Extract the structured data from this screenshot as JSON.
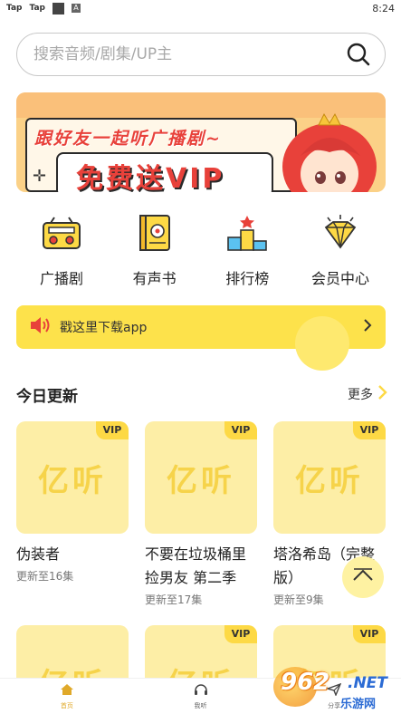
{
  "status_bar": {
    "left_items": [
      "Tap",
      "Tap"
    ],
    "a_badge": "A",
    "time": "8:24"
  },
  "search": {
    "placeholder": "搜索音频/剧集/UP主"
  },
  "banner": {
    "title": "跟好友一起听广播剧~",
    "main": "免费送VIP"
  },
  "categories": [
    {
      "label": "广播剧",
      "icon": "radio-icon"
    },
    {
      "label": "有声书",
      "icon": "audiobook-icon"
    },
    {
      "label": "排行榜",
      "icon": "podium-icon"
    },
    {
      "label": "会员中心",
      "icon": "diamond-icon"
    }
  ],
  "download": {
    "label": "戳这里下载app"
  },
  "section": {
    "title": "今日更新",
    "more": "更多"
  },
  "cards": [
    {
      "title": "伪装者",
      "sub": "更新至16集",
      "badge": "VIP",
      "cover_text": "亿听"
    },
    {
      "title": "不要在垃圾桶里捡男友 第二季",
      "sub": "更新至17集",
      "badge": "VIP",
      "cover_text": "亿听"
    },
    {
      "title": "塔洛希岛（完整版）",
      "sub": "更新至9集",
      "badge": "VIP",
      "cover_text": "亿听"
    },
    {
      "title": "",
      "sub": "",
      "badge": "",
      "cover_text": "亿听"
    },
    {
      "title": "",
      "sub": "",
      "badge": "VIP",
      "cover_text": "亿听"
    },
    {
      "title": "",
      "sub": "",
      "badge": "VIP",
      "cover_text": "亿听"
    }
  ],
  "tabbar": [
    {
      "label": "首页",
      "icon": "home-icon",
      "active": true
    },
    {
      "label": "我听",
      "icon": "headphones-icon",
      "active": false
    },
    {
      "label": "分享",
      "icon": "share-icon",
      "active": false
    }
  ],
  "watermark": {
    "num": "962",
    "net": ".NET",
    "cn": "乐游网"
  },
  "colors": {
    "accent": "#fde24b",
    "cover": "#fdeea6",
    "banner_red": "#e8413a"
  }
}
